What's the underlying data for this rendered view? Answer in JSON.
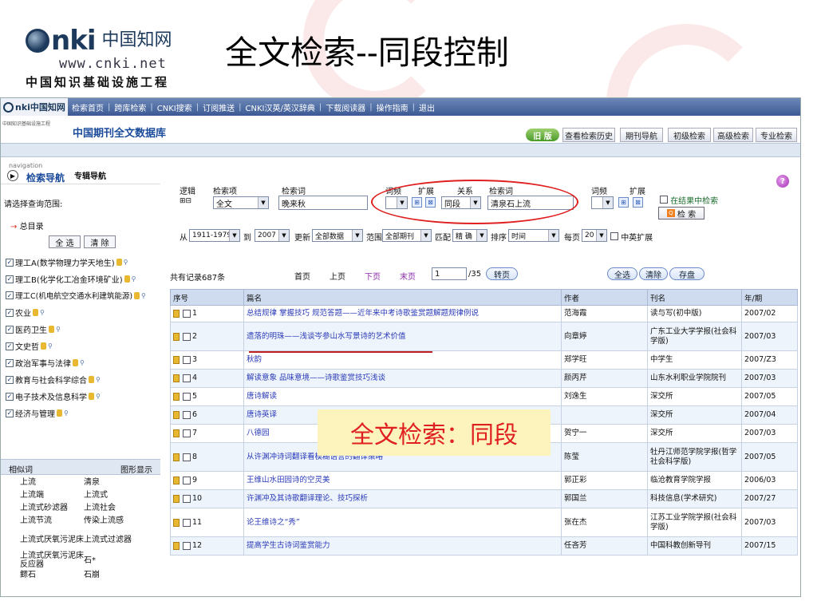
{
  "slide": {
    "title": "全文检索--同段控制",
    "logo_brand": "nki",
    "logo_cn": "中国知网",
    "logo_url": "www.cnki.net",
    "logo_sub": "中国知识基础设施工程",
    "callout": "全文检索：同段"
  },
  "topnav": {
    "logo_text": "nki中国知网",
    "items": [
      "检索首页",
      "跨库检索",
      "CNKI搜索",
      "订阅推送",
      "CNKI汉英/英汉辞典",
      "下载阅读器",
      "操作指南",
      "退出"
    ]
  },
  "header": {
    "small": "中国知识基础设施工程",
    "db_title": "中国期刊全文数据库",
    "old_version": "旧 版",
    "tabs": [
      "查看检索历史",
      "期刊导航",
      "初级检索",
      "高级检索",
      "专业检索"
    ]
  },
  "left": {
    "navigation": "navigation",
    "nav_title": "检索导航",
    "topic_nav": "专辑导航",
    "scope": "请选择查询范围:",
    "catalog": "总目录",
    "select_all": "全 选",
    "clear": "清 除",
    "categories": [
      "理工A(数学物理力学天地生)",
      "理工B(化学化工冶金环境矿业)",
      "理工C(机电航空交通水利建筑能源)",
      "农业",
      "医药卫生",
      "文史哲",
      "政治军事与法律",
      "教育与社会科学综合",
      "电子技术及信息科学",
      "经济与管理"
    ],
    "related_label": "相似词",
    "graph_label": "图形显示",
    "related_words": [
      [
        "上流",
        "清泉"
      ],
      [
        "上流端",
        "上流式"
      ],
      [
        "上流式砂滤器",
        "上流社会"
      ],
      [
        "上流节流",
        "传染上流感"
      ],
      [
        "上流式厌氧污泥床",
        "上流式过滤器"
      ],
      [
        "上流式厌氧污泥床反应器",
        "石*"
      ],
      [
        "鳏石",
        "石崩"
      ]
    ]
  },
  "search": {
    "logic_label": "逻辑",
    "field_label": "检索项",
    "term_label": "检索词",
    "freq_label": "词频",
    "expand_label": "扩展",
    "relation_label": "关系",
    "term2_label": "检索词",
    "freq2_label": "词频",
    "expand2_label": "扩展",
    "field_value": "全文",
    "term_value": "晚来秋",
    "relation_value": "同段",
    "term2_value": "清泉石上流",
    "in_result": "在结果中检索",
    "search_button": "检 索",
    "from_label": "从",
    "from_value": "1911-1979",
    "to_label": "到",
    "to_value": "2007",
    "update_label": "更新",
    "update_value": "全部数据",
    "range_label": "范围",
    "range_value": "全部期刊",
    "match_label": "匹配",
    "match_value": "精 确",
    "sort_label": "排序",
    "sort_value": "时间",
    "per_page_label": "每页",
    "per_page_value": "20",
    "cn_en": "中英扩展"
  },
  "pager": {
    "total": "共有记录687条",
    "first": "首页",
    "prev": "上页",
    "next": "下页",
    "last": "末页",
    "page_input": "1",
    "pages": "/35",
    "go": "转页",
    "select_all": "全选",
    "clear": "清除",
    "save": "存盘"
  },
  "table": {
    "headers": [
      "序号",
      "篇名",
      "作者",
      "刊名",
      "年/期"
    ],
    "rows": [
      [
        "1",
        "总结规律 掌握技巧 规范答题——近年来中考诗歌鉴赏题解题规律例说",
        "范海霞",
        "读与写(初中版)",
        "2007/02"
      ],
      [
        "2",
        "遗落的明珠——浅谈岑参山水写景诗的艺术价值",
        "向章婷",
        "广东工业大学学报(社会科学版)",
        "2007/03"
      ],
      [
        "3",
        "秋韵",
        "郑学旺",
        "中学生",
        "2007/Z3"
      ],
      [
        "4",
        "解读意象 品味意境——诗歌鉴赏技巧浅谈",
        "颜丙芹",
        "山东水利职业学院院刊",
        "2007/03"
      ],
      [
        "5",
        "唐诗解读",
        "刘逸生",
        "深交所",
        "2007/05"
      ],
      [
        "6",
        "唐诗英译",
        "",
        "深交所",
        "2007/04"
      ],
      [
        "7",
        "八德园",
        "贺宁一",
        "深交所",
        "2007/03"
      ],
      [
        "8",
        "从许渊冲诗词翻译看模糊语言的翻译策略",
        "陈莹",
        "牡丹江师范学院学报(哲学社会科学版)",
        "2007/05"
      ],
      [
        "9",
        "王维山水田园诗的空灵美",
        "郭正彩",
        "临沧教育学院学报",
        "2006/03"
      ],
      [
        "10",
        "许渊冲及其诗歌翻译理论、技巧探析",
        "郭国兰",
        "科技信息(学术研究)",
        "2007/27"
      ],
      [
        "11",
        "论王维诗之“秀”",
        "张在杰",
        "江苏工业学院学报(社会科学版)",
        "2007/03"
      ],
      [
        "12",
        "提高学生古诗词鉴赏能力",
        "任吝芳",
        "中国科教创新导刊",
        "2007/15"
      ]
    ]
  }
}
